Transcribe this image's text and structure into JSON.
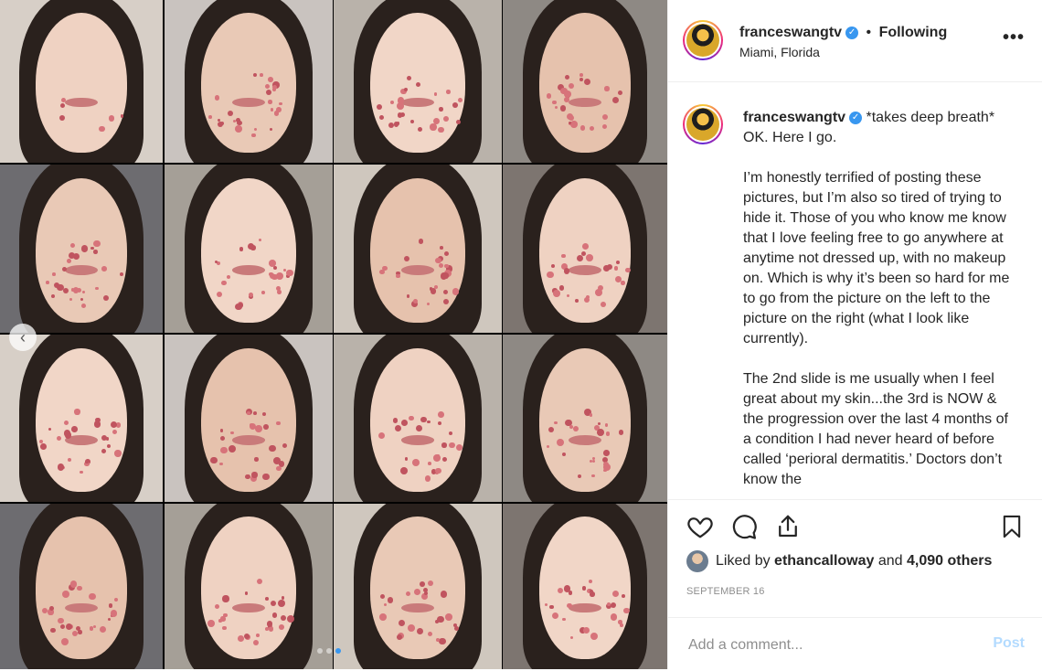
{
  "header": {
    "username": "franceswangtv",
    "separator": "•",
    "follow_label": "Following",
    "location": "Miami, Florida",
    "more_label": "•••"
  },
  "caption": {
    "username": "franceswangtv",
    "paragraphs": [
      "*takes deep breath* OK. Here I go.",
      "I’m honestly terrified of posting these pictures, but I’m also so tired of trying to hide it. Those of you who know me know that I love feeling free to go anywhere at anytime not dressed up, with no makeup on. Which is why it’s been so hard for me to go from the picture on the left to the picture on the right (what I look like currently).",
      "The 2nd slide is me usually when I feel great about my skin...the 3rd is NOW & the progression over the last 4 months of a condition I had never heard of before called ‘perioral dermatitis.’ Doctors don’t know the"
    ]
  },
  "likes": {
    "prefix": "Liked by",
    "user": "ethancalloway",
    "and": "and",
    "others": "4,090 others"
  },
  "date": "SEPTEMBER 16",
  "comment": {
    "placeholder": "Add a comment...",
    "post_label": "Post"
  },
  "carousel": {
    "prev_label": "‹",
    "dots": 3,
    "active_dot": 3
  },
  "icons": {
    "like": "heart-icon",
    "comment": "comment-icon",
    "share": "share-icon",
    "save": "bookmark-icon",
    "verified": "verified-badge-icon"
  }
}
